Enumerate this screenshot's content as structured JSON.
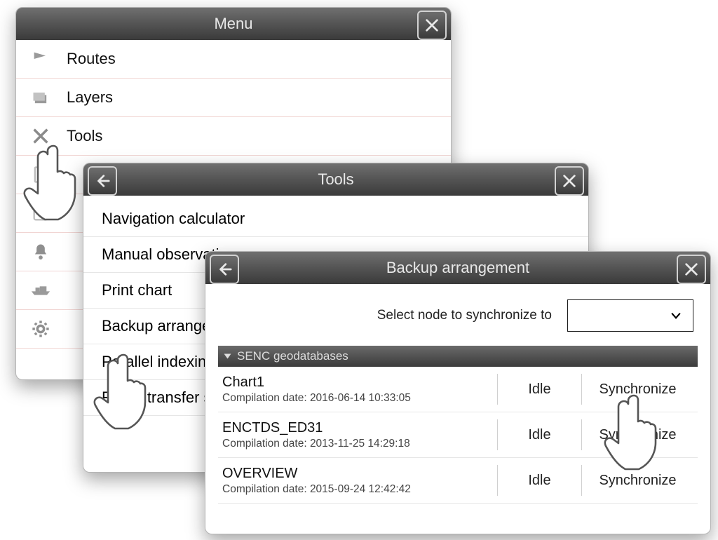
{
  "menu": {
    "title": "Menu",
    "items": [
      {
        "icon": "flag-icon",
        "label": "Routes"
      },
      {
        "icon": "layers-icon",
        "label": "Layers"
      },
      {
        "icon": "tools-icon",
        "label": "Tools"
      },
      {
        "icon": "doc-icon",
        "label": ""
      },
      {
        "icon": "cal-icon",
        "label": ""
      },
      {
        "icon": "bell-icon",
        "label": ""
      },
      {
        "icon": "ship-icon",
        "label": ""
      },
      {
        "icon": "gear-icon",
        "label": ""
      }
    ]
  },
  "tools": {
    "title": "Tools",
    "items": [
      "Navigation calculator",
      "Manual observation",
      "Print chart",
      "Backup arrangement",
      "Parallel indexing",
      "Route transfer status"
    ]
  },
  "backup": {
    "title": "Backup arrangement",
    "select_label": "Select node to synchronize to",
    "select_value": "",
    "section": "SENC geodatabases",
    "date_prefix": "Compilation date:",
    "rows": [
      {
        "name": "Chart1",
        "date": "2016-06-14 10:33:05",
        "status": "Idle",
        "action": "Synchronize"
      },
      {
        "name": "ENCTDS_ED31",
        "date": "2013-11-25 14:29:18",
        "status": "Idle",
        "action": "Synchronize"
      },
      {
        "name": "OVERVIEW",
        "date": "2015-09-24 12:42:42",
        "status": "Idle",
        "action": "Synchronize"
      }
    ]
  }
}
